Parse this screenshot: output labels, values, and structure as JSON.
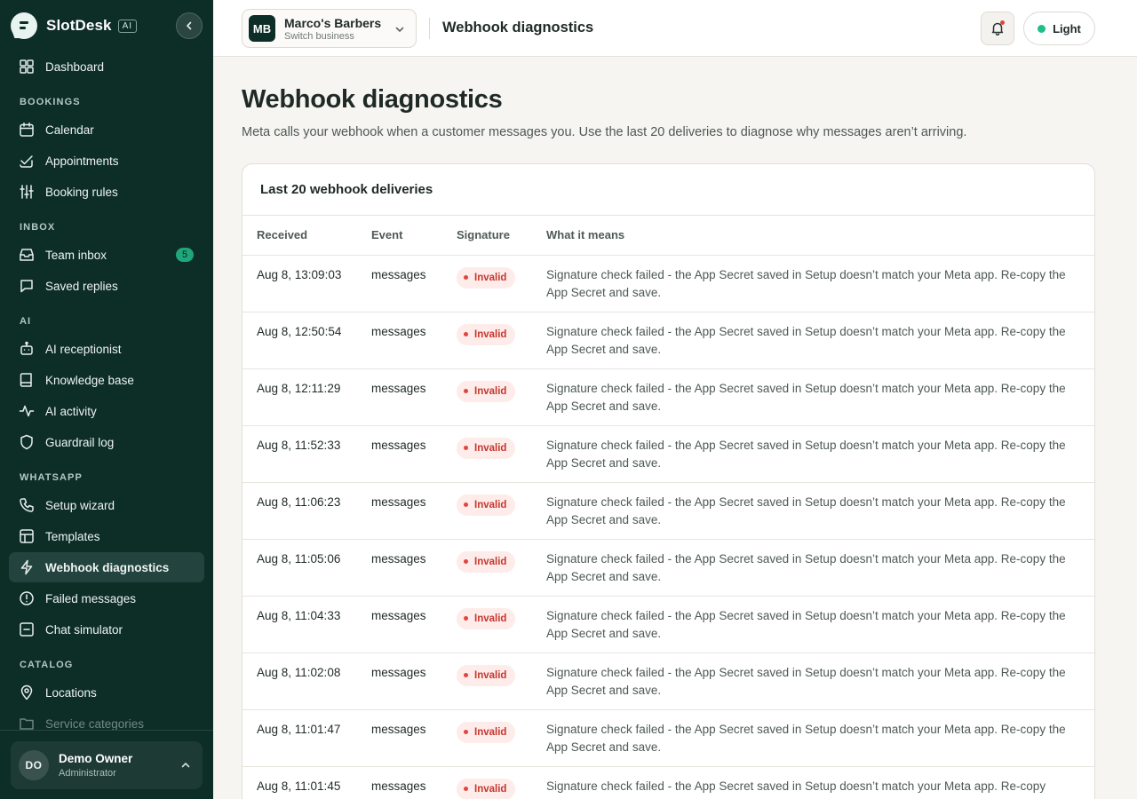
{
  "app": {
    "name": "SlotDesk",
    "badge": "AI"
  },
  "colors": {
    "sidebar_bg": "#0d2d27",
    "accent": "#1fbf88",
    "invalid": "#c7372f"
  },
  "sidebar": {
    "top": [
      {
        "label": "Dashboard",
        "icon": "dashboard-icon"
      }
    ],
    "sections": [
      {
        "title": "BOOKINGS",
        "items": [
          {
            "label": "Calendar",
            "icon": "calendar-icon"
          },
          {
            "label": "Appointments",
            "icon": "checklist-icon"
          },
          {
            "label": "Booking rules",
            "icon": "sliders-icon"
          }
        ]
      },
      {
        "title": "INBOX",
        "items": [
          {
            "label": "Team inbox",
            "icon": "inbox-icon",
            "count": "5"
          },
          {
            "label": "Saved replies",
            "icon": "message-icon"
          }
        ]
      },
      {
        "title": "AI",
        "items": [
          {
            "label": "AI receptionist",
            "icon": "bot-icon"
          },
          {
            "label": "Knowledge base",
            "icon": "book-icon"
          },
          {
            "label": "AI activity",
            "icon": "activity-icon"
          },
          {
            "label": "Guardrail log",
            "icon": "shield-icon"
          }
        ]
      },
      {
        "title": "WHATSAPP",
        "items": [
          {
            "label": "Setup wizard",
            "icon": "phone-icon"
          },
          {
            "label": "Templates",
            "icon": "template-icon"
          },
          {
            "label": "Webhook diagnostics",
            "icon": "bolt-icon",
            "active": true
          },
          {
            "label": "Failed messages",
            "icon": "alert-icon"
          },
          {
            "label": "Chat simulator",
            "icon": "chat-icon"
          }
        ]
      },
      {
        "title": "CATALOG",
        "items": [
          {
            "label": "Locations",
            "icon": "pin-icon"
          },
          {
            "label": "Service categories",
            "icon": "folder-icon"
          }
        ]
      }
    ],
    "user": {
      "initials": "DO",
      "name": "Demo Owner",
      "role": "Administrator"
    }
  },
  "topbar": {
    "business": {
      "initials": "MB",
      "name": "Marco's Barbers",
      "sub": "Switch business"
    },
    "title": "Webhook diagnostics",
    "theme_label": "Light"
  },
  "page": {
    "title": "Webhook diagnostics",
    "description": "Meta calls your webhook when a customer messages you. Use the last 20 deliveries to diagnose why messages aren’t arriving."
  },
  "deliveries": {
    "title": "Last 20 webhook deliveries",
    "columns": [
      "Received",
      "Event",
      "Signature",
      "What it means"
    ],
    "rows": [
      {
        "received": "Aug 8, 13:09:03",
        "event": "messages",
        "signature": "Invalid",
        "meaning": "Signature check failed - the App Secret saved in Setup doesn’t match your Meta app. Re-copy the App Secret and save."
      },
      {
        "received": "Aug 8, 12:50:54",
        "event": "messages",
        "signature": "Invalid",
        "meaning": "Signature check failed - the App Secret saved in Setup doesn’t match your Meta app. Re-copy the App Secret and save."
      },
      {
        "received": "Aug 8, 12:11:29",
        "event": "messages",
        "signature": "Invalid",
        "meaning": "Signature check failed - the App Secret saved in Setup doesn’t match your Meta app. Re-copy the App Secret and save."
      },
      {
        "received": "Aug 8, 11:52:33",
        "event": "messages",
        "signature": "Invalid",
        "meaning": "Signature check failed - the App Secret saved in Setup doesn’t match your Meta app. Re-copy the App Secret and save."
      },
      {
        "received": "Aug 8, 11:06:23",
        "event": "messages",
        "signature": "Invalid",
        "meaning": "Signature check failed - the App Secret saved in Setup doesn’t match your Meta app. Re-copy the App Secret and save."
      },
      {
        "received": "Aug 8, 11:05:06",
        "event": "messages",
        "signature": "Invalid",
        "meaning": "Signature check failed - the App Secret saved in Setup doesn’t match your Meta app. Re-copy the App Secret and save."
      },
      {
        "received": "Aug 8, 11:04:33",
        "event": "messages",
        "signature": "Invalid",
        "meaning": "Signature check failed - the App Secret saved in Setup doesn’t match your Meta app. Re-copy the App Secret and save."
      },
      {
        "received": "Aug 8, 11:02:08",
        "event": "messages",
        "signature": "Invalid",
        "meaning": "Signature check failed - the App Secret saved in Setup doesn’t match your Meta app. Re-copy the App Secret and save."
      },
      {
        "received": "Aug 8, 11:01:47",
        "event": "messages",
        "signature": "Invalid",
        "meaning": "Signature check failed - the App Secret saved in Setup doesn’t match your Meta app. Re-copy the App Secret and save."
      },
      {
        "received": "Aug 8, 11:01:45",
        "event": "messages",
        "signature": "Invalid",
        "meaning": "Signature check failed - the App Secret saved in Setup doesn’t match your Meta app. Re-copy"
      }
    ]
  }
}
